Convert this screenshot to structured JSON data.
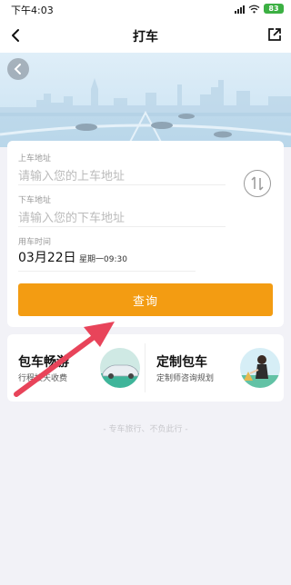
{
  "status": {
    "time": "下午4:03",
    "battery": "83"
  },
  "nav": {
    "title": "打车"
  },
  "form": {
    "pickup_label": "上车地址",
    "pickup_placeholder": "请输入您的上车地址",
    "dropoff_label": "下车地址",
    "dropoff_placeholder": "请输入您的下车地址",
    "time_label": "用车时间",
    "date": "03月22日",
    "weekday_time": "星期一09:30",
    "query_label": "查询"
  },
  "services": [
    {
      "title": "包车畅游",
      "subtitle": "行程按天收费"
    },
    {
      "title": "定制包车",
      "subtitle": "定制师咨询规划"
    }
  ],
  "slogan": "- 专车旅行、不负此行 -",
  "colors": {
    "accent": "#f39c12",
    "arrow": "#e8445a"
  }
}
